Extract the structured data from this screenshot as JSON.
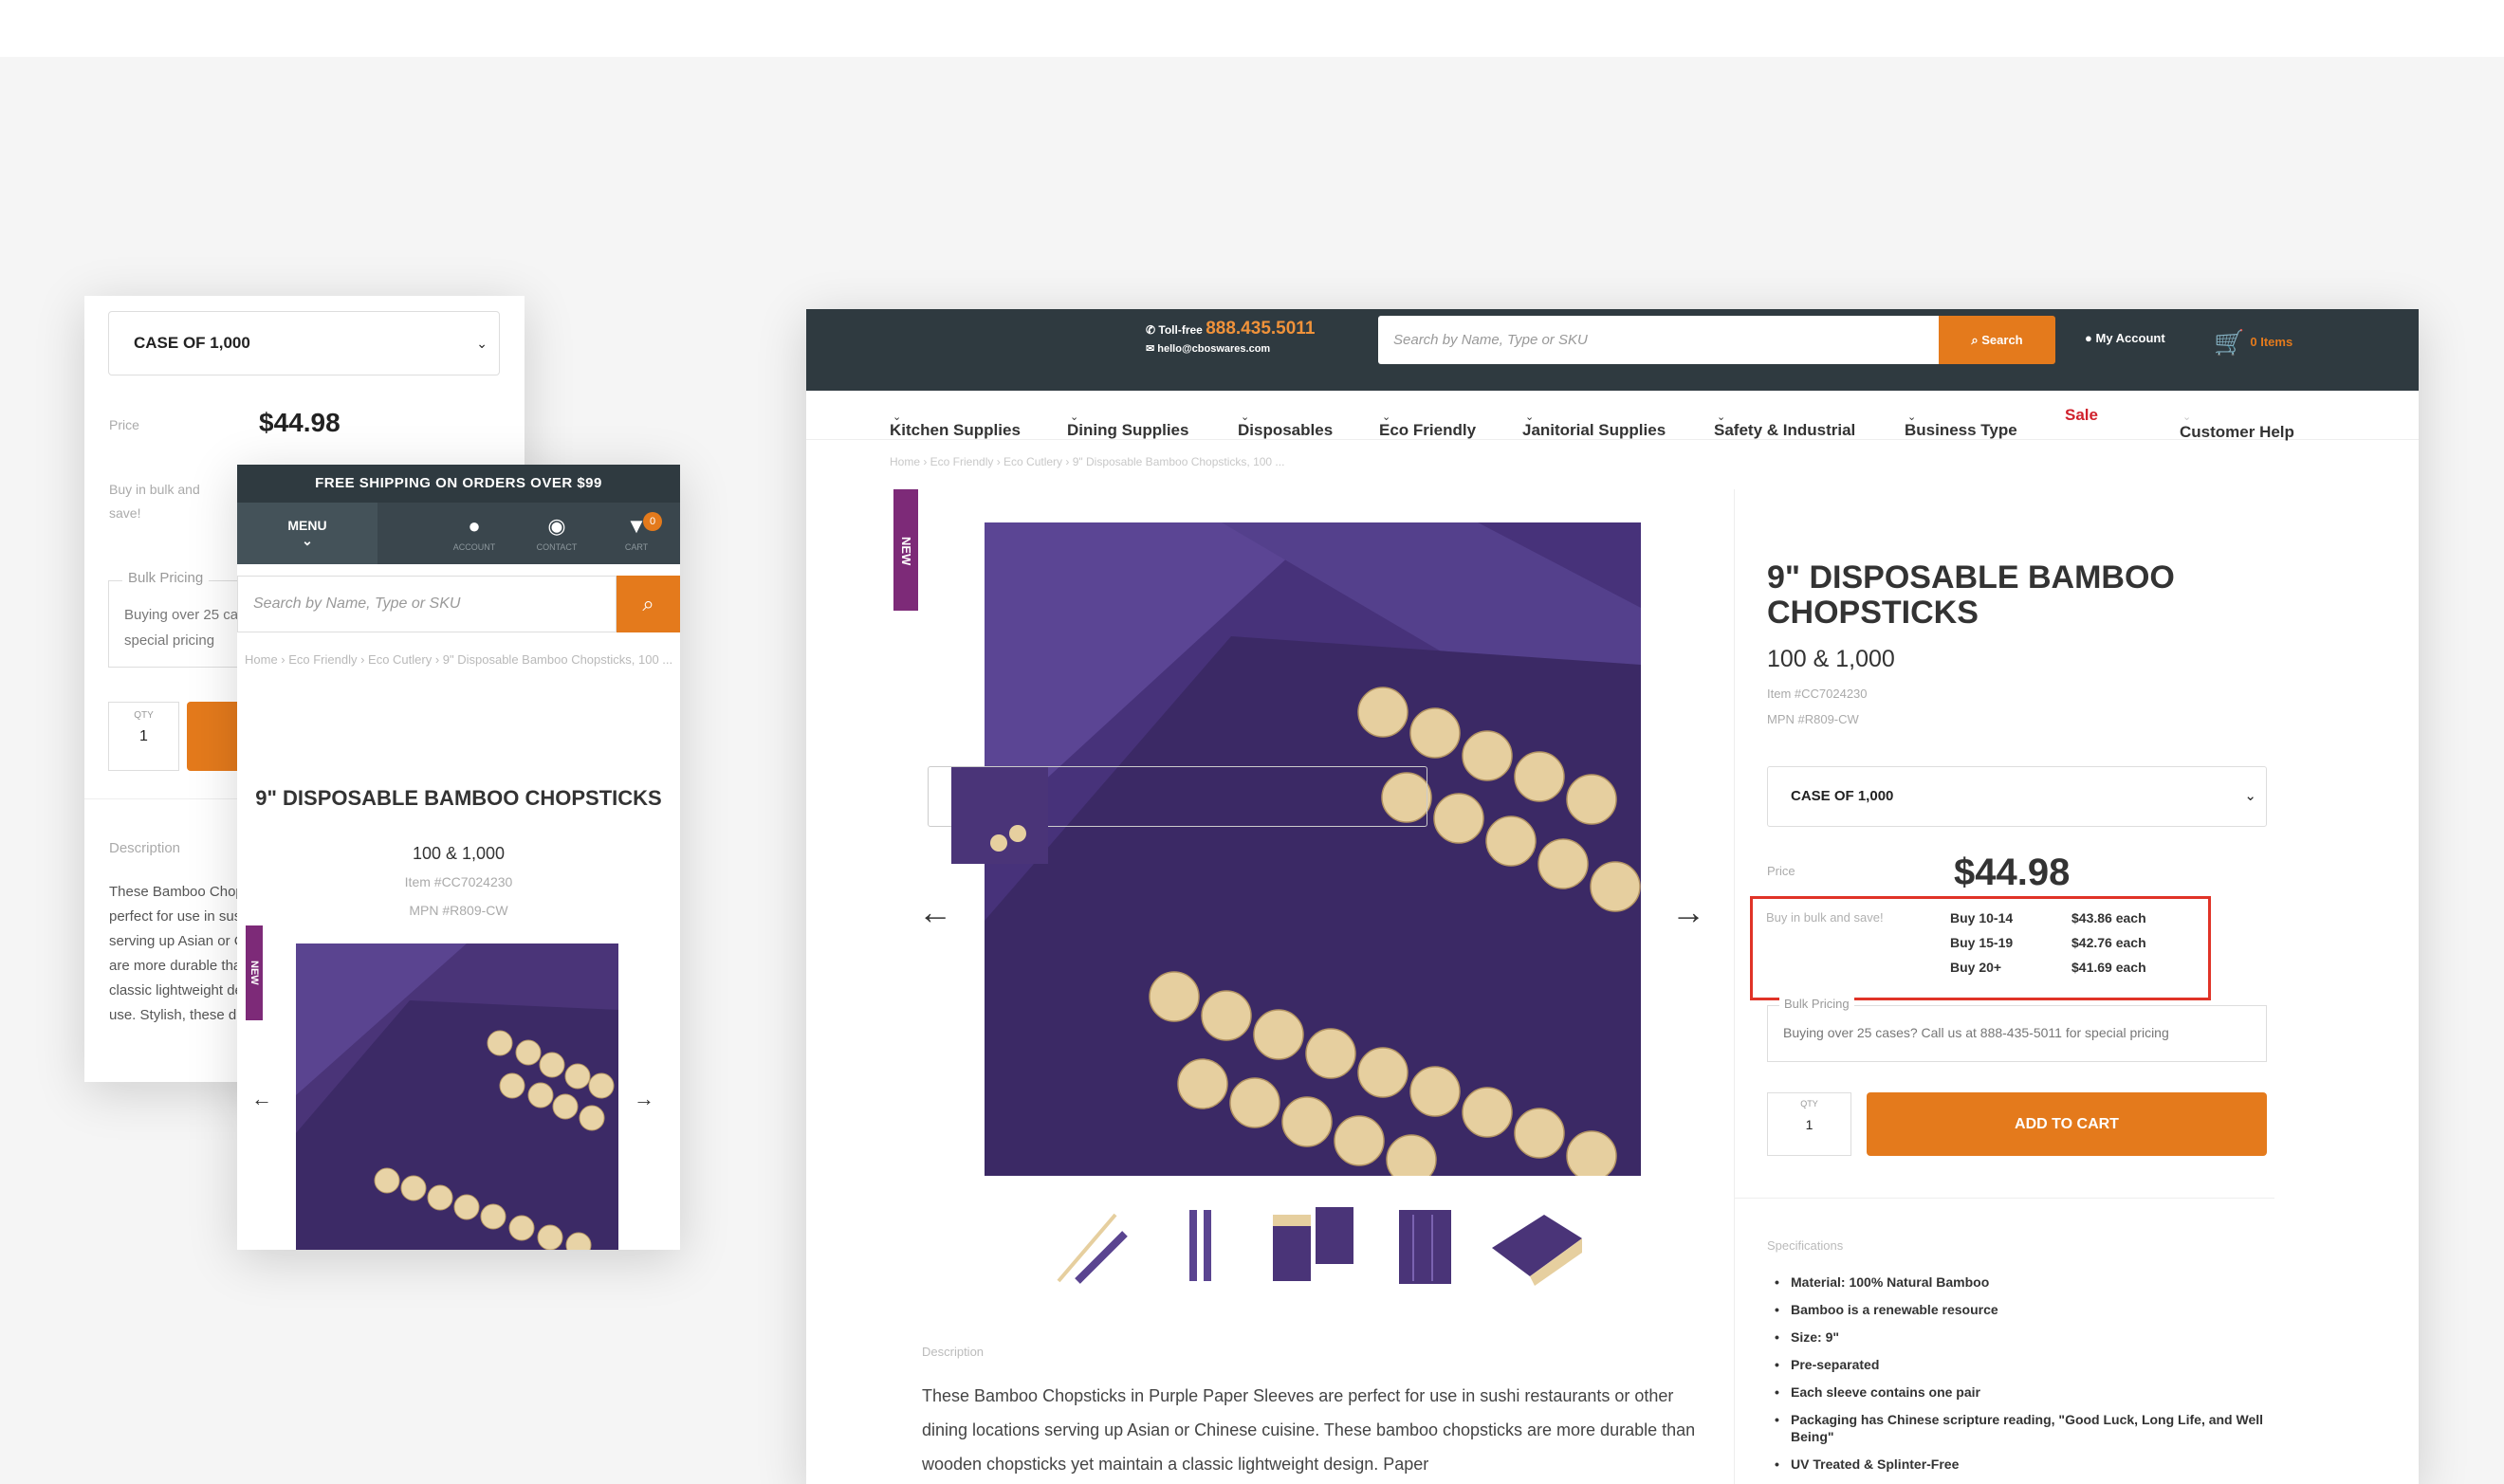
{
  "back_mobile": {
    "case_select": "CASE OF 1,000",
    "price_label": "Price",
    "price": "$44.98",
    "bulk_label": "Buy in bulk and save!",
    "bulk_pricing_legend": "Bulk Pricing",
    "bulk_pricing_text": "Buying over 25 cases? Call us at 888-435-5011 for special pricing",
    "qty_label": "QTY",
    "qty_value": "1",
    "description_label": "Description",
    "description_text": "These Bamboo Chopsticks in Purple Paper Sleeves are perfect for use in sushi restaurants or other dining locations serving up Asian or Chinese cuisine. These bamboo chopsticks are more durable than wooden chopsticks yet maintain a classic lightweight design. Paper sleeves help ensure sanitary use. Stylish, these durable"
  },
  "front_mobile": {
    "shipping_banner": "FREE SHIPPING ON ORDERS OVER $99",
    "menu_label": "MENU",
    "nav_account": "ACCOUNT",
    "nav_contact": "CONTACT",
    "nav_cart": "CART",
    "cart_count": "0",
    "search_placeholder": "Search by Name, Type or SKU",
    "breadcrumb": "Home  ›  Eco Friendly  ›  Eco Cutlery  ›  9\" Disposable Bamboo Chopsticks, 100 ...",
    "title": "9\" DISPOSABLE BAMBOO CHOPSTICKS",
    "pack": "100 & 1,000",
    "item": "Item #CC7024230",
    "mpn": "MPN #R809-CW",
    "new_tag": "NEW"
  },
  "desktop": {
    "phone_label": "Toll-free",
    "phone": "888.435.5011",
    "email": "hello@cboswares.com",
    "search_placeholder": "Search by Name, Type or SKU",
    "search_button": "Search",
    "account": "My Account",
    "cart": "0 Items",
    "menu": {
      "kitchen": "Kitchen Supplies",
      "dining": "Dining Supplies",
      "disposables": "Disposables",
      "eco": "Eco Friendly",
      "janitorial": "Janitorial Supplies",
      "safety": "Safety & Industrial",
      "business": "Business Type",
      "sale": "Sale",
      "help": "Customer Help"
    },
    "breadcrumb": "Home   ›   Eco Friendly   ›   Eco Cutlery   ›   9\" Disposable Bamboo Chopsticks, 100 ...",
    "new_tag": "NEW",
    "title": "9\" DISPOSABLE BAMBOO CHOPSTICKS",
    "pack": "100 & 1,000",
    "item": "Item #CC7024230",
    "mpn": "MPN #R809-CW",
    "case_select": "CASE OF 1,000",
    "price_label": "Price",
    "price": "$44.98",
    "bulk_label": "Buy in bulk and save!",
    "bulk_rows": [
      {
        "qty": "Buy 10-14",
        "price": "$43.86 each"
      },
      {
        "qty": "Buy 15-19",
        "price": "$42.76 each"
      },
      {
        "qty": "Buy 20+",
        "price": "$41.69 each"
      }
    ],
    "bulk_pricing_legend": "Bulk Pricing",
    "bulk_pricing_text": "Buying over 25 cases? Call us at 888-435-5011 for special pricing",
    "qty_label": "QTY",
    "qty_value": "1",
    "add_to_cart": "ADD TO CART",
    "specs_label": "Specifications",
    "specs": [
      "Material: 100% Natural Bamboo",
      "Bamboo is a renewable resource",
      "Size: 9\"",
      "Pre-separated",
      "Each sleeve contains one pair",
      "Packaging has Chinese scripture reading, \"Good Luck, Long Life, and Well Being\"",
      "UV Treated & Splinter-Free"
    ],
    "description_label": "Description",
    "description_text": "These Bamboo Chopsticks in Purple Paper Sleeves are perfect for use in sushi restaurants or other dining locations serving up Asian or Chinese cuisine. These bamboo chopsticks are more durable than wooden chopsticks yet maintain a classic lightweight design. Paper"
  },
  "colors": {
    "header": "#2f3a40",
    "accent": "#e47a1c",
    "sale": "#d0212c",
    "new_tag": "#7d2a78",
    "highlight_box": "#e03327",
    "sleeve": "#3e2a68"
  }
}
